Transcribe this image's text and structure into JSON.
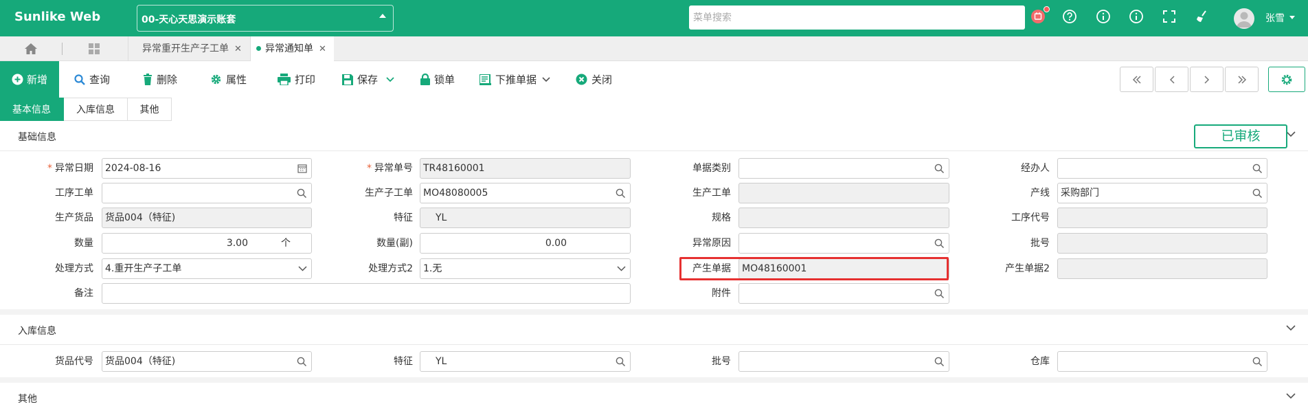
{
  "app": {
    "brand": "Sunlike Web",
    "account": "00-天心天思演示账套",
    "search_placeholder": "菜单搜索",
    "user": "张雪"
  },
  "open_tabs": [
    {
      "label": "异常重开生产子工单",
      "active": false
    },
    {
      "label": "异常通知单",
      "active": true
    }
  ],
  "toolbar": {
    "new": "新增",
    "query": "查询",
    "delete": "删除",
    "properties": "属性",
    "print": "打印",
    "save": "保存",
    "lock": "锁单",
    "push_down": "下推单据",
    "close": "关闭"
  },
  "section_tabs": [
    "基本信息",
    "入库信息",
    "其他"
  ],
  "status": "已审核",
  "sections": {
    "basic": "基础信息",
    "storage": "入库信息",
    "other": "其他"
  },
  "basic_fields": {
    "abnormal_date": {
      "label": "异常日期",
      "value": "2024-08-16"
    },
    "abnormal_no": {
      "label": "异常单号",
      "value": "TR48160001"
    },
    "doc_type": {
      "label": "单据类别",
      "value": ""
    },
    "handler": {
      "label": "经办人",
      "value": ""
    },
    "process_order": {
      "label": "工序工单",
      "value": ""
    },
    "prod_sub_order": {
      "label": "生产子工单",
      "value": "MO48080005"
    },
    "prod_order": {
      "label": "生产工单",
      "value": ""
    },
    "line": {
      "label": "产线",
      "value": "采购部门"
    },
    "prod_goods": {
      "label": "生产货品",
      "value": "货品004（特征)"
    },
    "feature": {
      "label": "特征",
      "value": "YL"
    },
    "spec": {
      "label": "规格",
      "value": ""
    },
    "process_code": {
      "label": "工序代号",
      "value": ""
    },
    "qty": {
      "label": "数量",
      "value": "3.00",
      "unit": "个"
    },
    "qty_sub": {
      "label": "数量(副)",
      "value": "0.00"
    },
    "reason": {
      "label": "异常原因",
      "value": ""
    },
    "lot": {
      "label": "批号",
      "value": ""
    },
    "method": {
      "label": "处理方式",
      "value": "4.重开生产子工单"
    },
    "method2": {
      "label": "处理方式2",
      "value": "1.无"
    },
    "gen_doc": {
      "label": "产生单据",
      "value": "MO48160001"
    },
    "gen_doc2": {
      "label": "产生单据2",
      "value": ""
    },
    "remark": {
      "label": "备注",
      "value": ""
    },
    "attachment": {
      "label": "附件",
      "value": ""
    }
  },
  "storage_fields": {
    "goods_code": {
      "label": "货品代号",
      "value": "货品004（特征)"
    },
    "feature": {
      "label": "特征",
      "value": "YL"
    },
    "lot": {
      "label": "批号",
      "value": ""
    },
    "warehouse": {
      "label": "仓库",
      "value": ""
    }
  },
  "colors": {
    "brand": "#16a97a",
    "highlight": "#e63030",
    "required": "#e8623a"
  }
}
